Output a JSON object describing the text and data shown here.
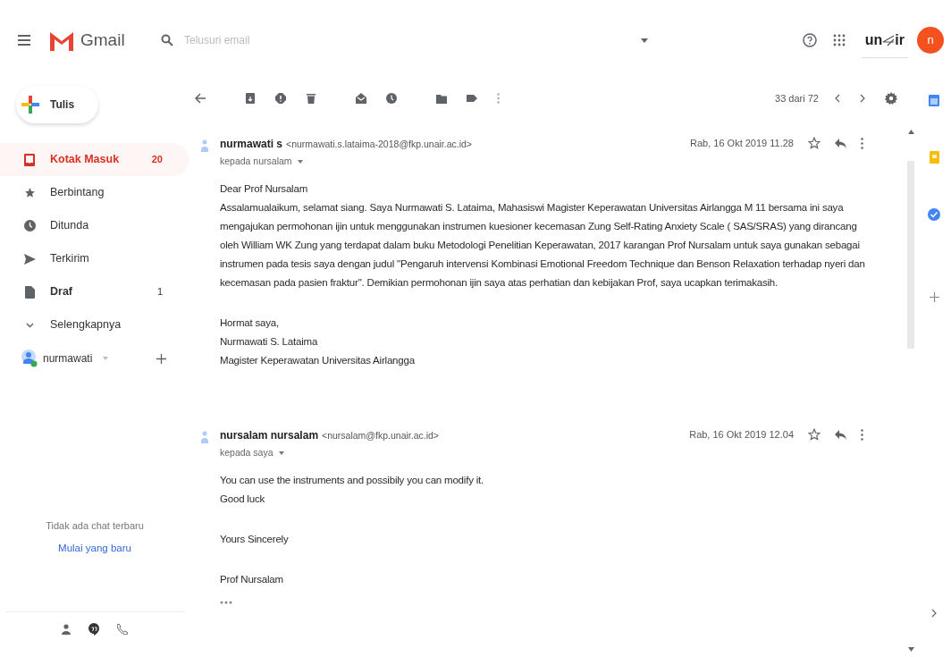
{
  "header": {
    "app_name": "Gmail",
    "search": {
      "placeholder": "Telusuri email"
    },
    "org_logo": {
      "left": "un",
      "right": "ir"
    },
    "avatar_letter": "n"
  },
  "sidebar": {
    "compose": "Tulis",
    "items": [
      {
        "label": "Kotak Masuk",
        "count": "20",
        "selected": true,
        "unread": true
      },
      {
        "label": "Berbintang",
        "selected": false,
        "unread": false
      },
      {
        "label": "Ditunda",
        "selected": false,
        "unread": false
      },
      {
        "label": "Terkirim",
        "selected": false,
        "unread": false
      },
      {
        "label": "Draf",
        "count": "1",
        "selected": false,
        "unread": true
      },
      {
        "label": "Selengkapnya",
        "selected": false,
        "unread": false
      }
    ],
    "user": {
      "name": "nurmawati",
      "online": true
    },
    "chat": {
      "empty": "Tidak ada chat terbaru",
      "start_link": "Mulai yang baru"
    }
  },
  "toolbar": {
    "pager": "33 dari 72"
  },
  "messages": [
    {
      "sender": "nurmawati s",
      "email": "<nurmawati.s.lataima-2018@fkp.unair.ac.id>",
      "recipient": "kepada nursalam",
      "date": "Rab, 16 Okt 2019 11.28",
      "starred": false,
      "paragraphs": [
        [
          "Dear Prof Nursalam",
          "Assalamualaikum, selamat siang. Saya Nurmawati S. Lataima, Mahasiswi Magister Keperawatan Universitas Airlangga M 11 bersama ini saya mengajukan permohonan ijin untuk menggunakan instrumen kuesioner kecemasan Zung Self-Rating Anxiety Scale ( SAS/SRAS) yang dirancang oleh William WK Zung yang terdapat dalam buku Metodologi Penelitian Keperawatan, 2017 karangan Prof Nursalam untuk saya gunakan sebagai instrumen pada tesis saya dengan judul \"Pengaruh intervensi Kombinasi Emotional Freedom Technique dan Benson Relaxation terhadap nyeri dan kecemasan pada pasien fraktur\". Demikian permohonan ijin saya atas perhatian dan kebijakan Prof, saya ucapkan terimakasih."
        ],
        [
          "Hormat saya,",
          "Nurmawati S. Lataima",
          "Magister Keperawatan Universitas Airlangga"
        ]
      ],
      "trimmed": false
    },
    {
      "sender": "nursalam nursalam",
      "email": "<nursalam@fkp.unair.ac.id>",
      "recipient": "kepada saya",
      "date": "Rab, 16 Okt 2019 12.04",
      "starred": false,
      "paragraphs": [
        [
          "You can use the instruments and possibily you can modify it.",
          "Good luck"
        ],
        [
          "Yours Sincerely"
        ],
        [
          "Prof Nursalam"
        ]
      ],
      "trimmed": true
    }
  ]
}
